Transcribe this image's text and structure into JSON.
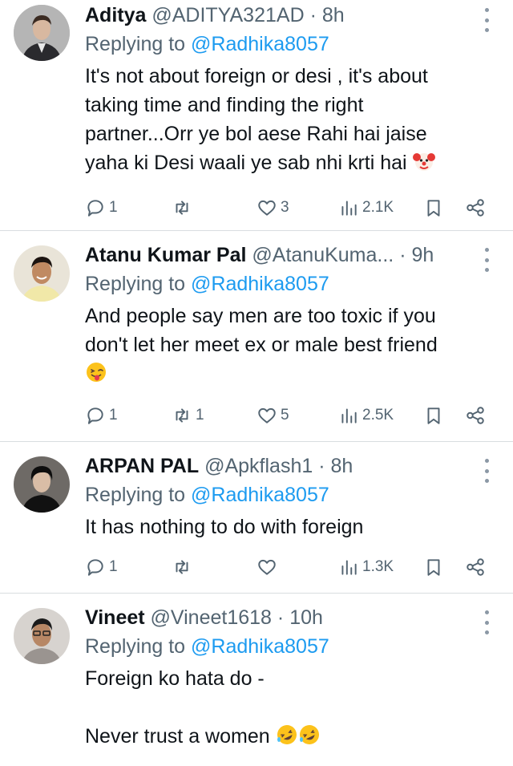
{
  "replies": [
    {
      "name": "Aditya",
      "handle": "@ADITYA321AD",
      "time": "· 8h",
      "replying_prefix": "Replying to",
      "replying_to": "@Radhika8057",
      "lines": [
        "It's not about foreign or desi , it's about",
        "taking time and finding the right",
        "partner...Orr ye bol aese Rahi hai jaise",
        "yaha ki Desi waali ye sab nhi krti hai"
      ],
      "trailing_emoji": "clown-face",
      "replies_count": "1",
      "retweets_count": "",
      "likes_count": "3",
      "views_count": "2.1K"
    },
    {
      "name": "Atanu Kumar Pal",
      "handle": "@AtanuKuma...",
      "time": "· 9h",
      "replying_prefix": "Replying to",
      "replying_to": "@Radhika8057",
      "lines": [
        "And people say men are too toxic if you",
        "don't let her meet ex or male best friend"
      ],
      "trailing_emoji": "winking-face-with-tongue",
      "replies_count": "1",
      "retweets_count": "1",
      "likes_count": "5",
      "views_count": "2.5K"
    },
    {
      "name": "ARPAN PAL",
      "handle": "@Apkflash1",
      "time": "· 8h",
      "replying_prefix": "Replying to",
      "replying_to": "@Radhika8057",
      "lines": [
        "It has nothing to do with foreign"
      ],
      "replies_count": "1",
      "retweets_count": "",
      "likes_count": "",
      "views_count": "1.3K"
    },
    {
      "name": "Vineet",
      "handle": "@Vineet1618",
      "time": "· 10h",
      "replying_prefix": "Replying to",
      "replying_to": "@Radhika8057",
      "lines": [
        "Foreign ko hata do -",
        "",
        "Never trust a women"
      ],
      "trailing_emoji": "rolling-on-floor-laughing x2"
    }
  ],
  "icons": {
    "reply": "reply-icon",
    "retweet": "retweet-icon",
    "like": "heart-icon",
    "views": "views-icon",
    "bookmark": "bookmark-icon",
    "share": "share-icon",
    "more": "more-dots-icon"
  },
  "colors": {
    "text": "#0f1419",
    "secondary": "#536471",
    "mention": "#1d9bf0",
    "divider": "#d9dde0"
  }
}
